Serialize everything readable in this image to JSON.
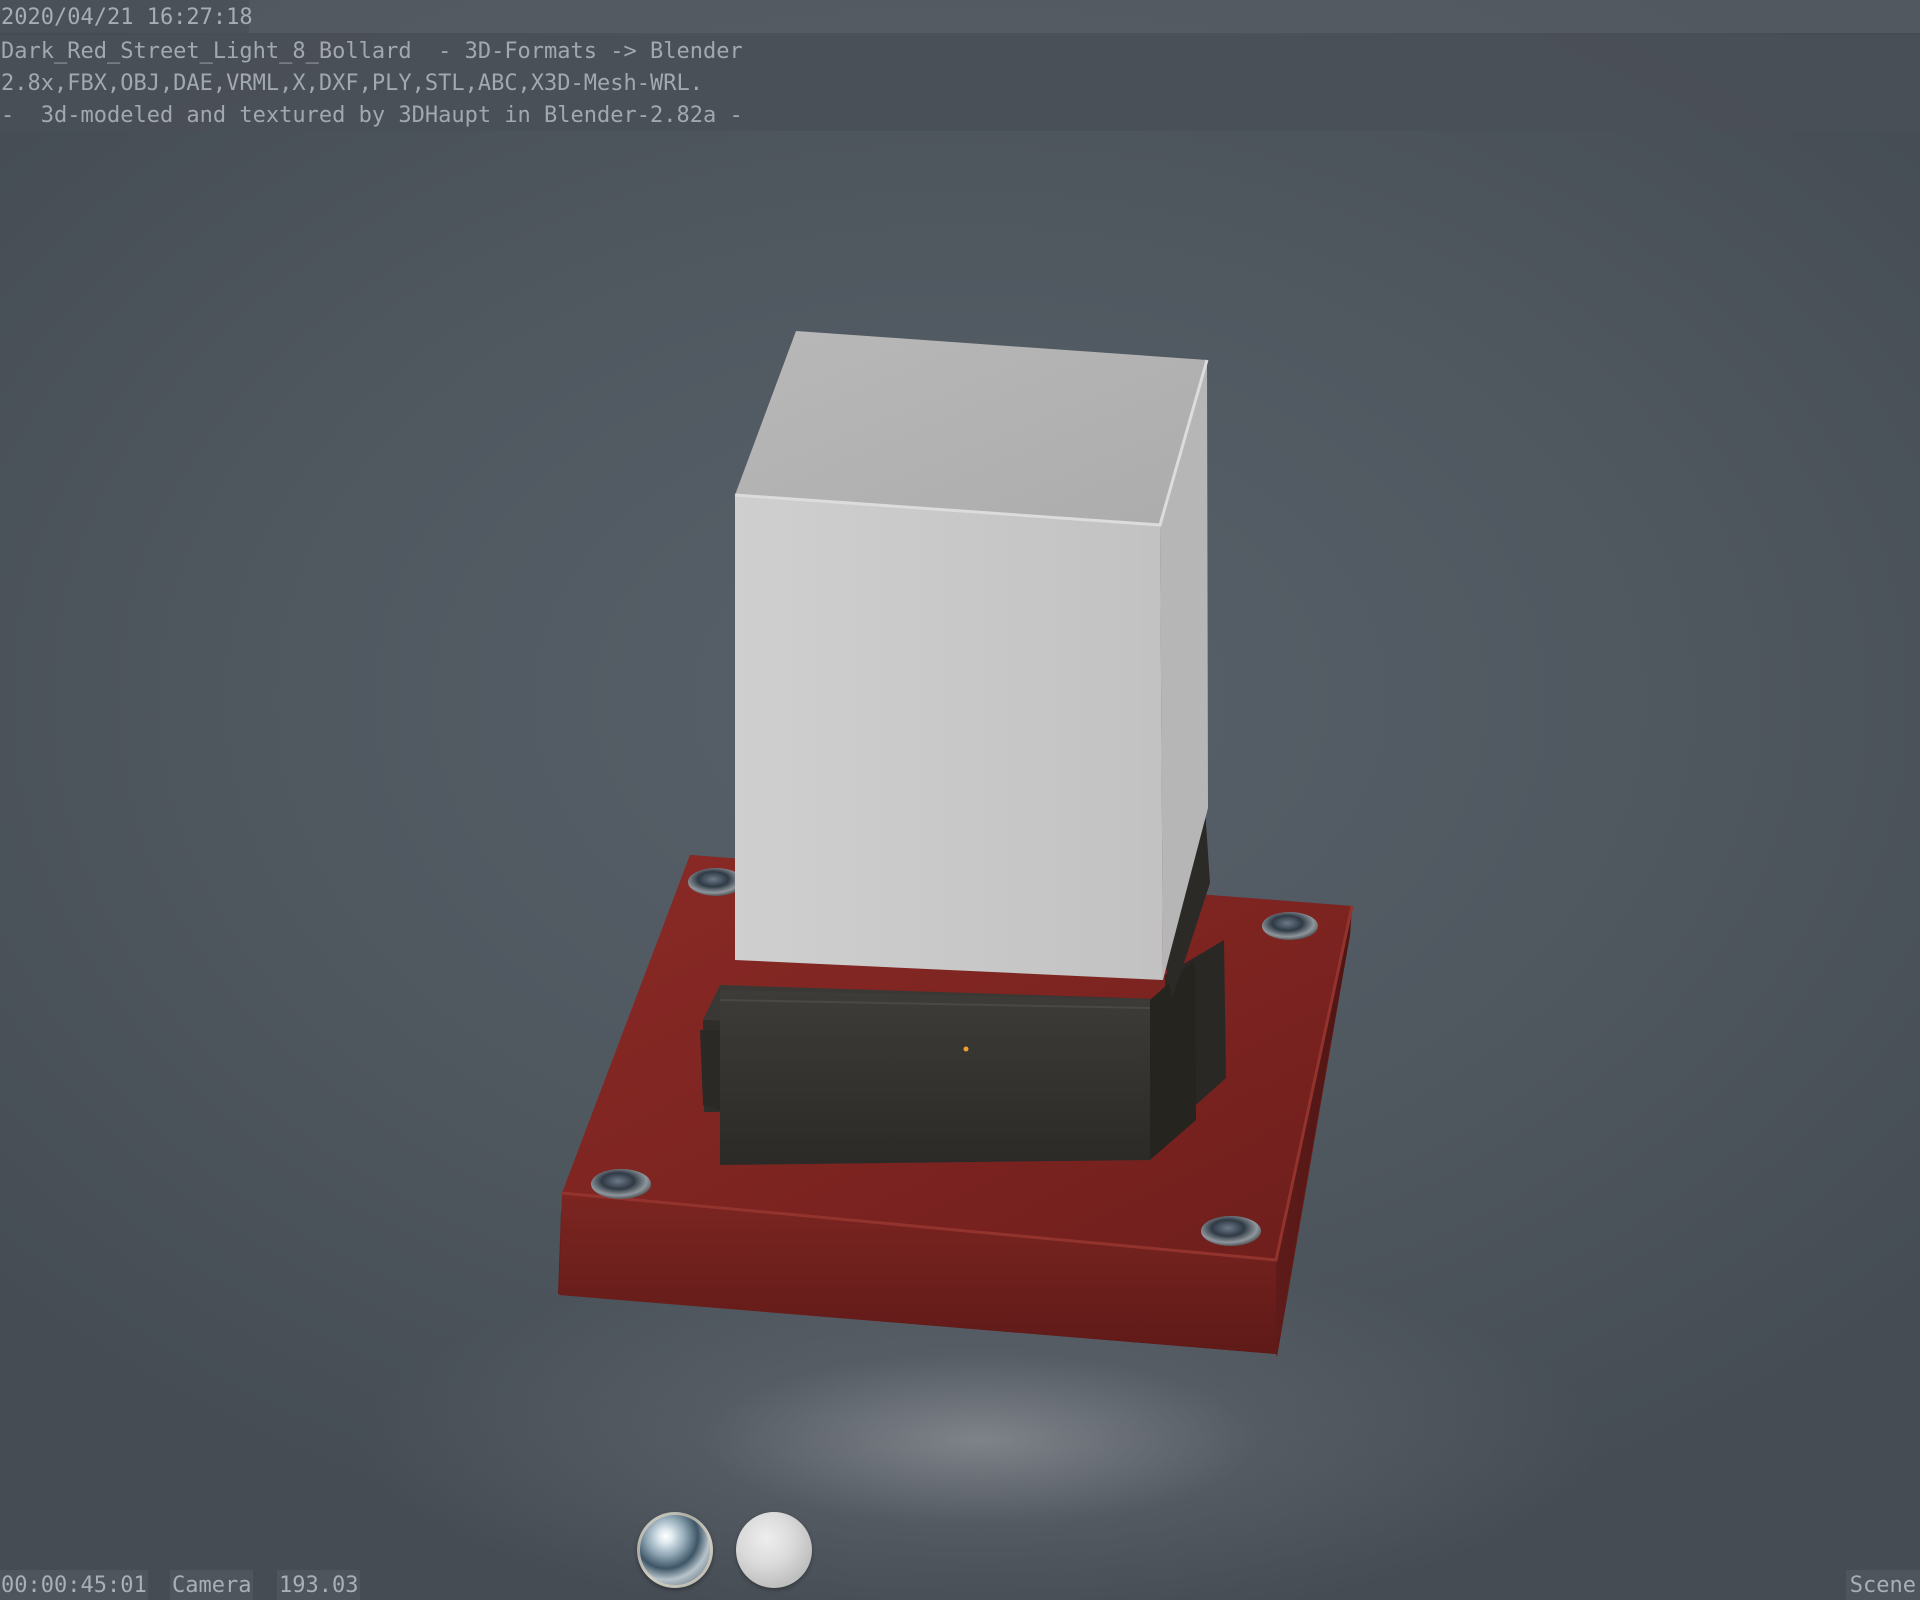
{
  "render_stamp": {
    "date": "2020/04/21 16:27:18",
    "note_line1": "Dark_Red_Street_Light_8_Bollard  - 3D-Formats -> Blender",
    "note_line2": "2.8x,FBX,OBJ,DAE,VRML,X,DXF,PLY,STL,ABC,X3D-Mesh-WRL.",
    "note_line3": "-  3d-modeled and textured by 3DHaupt in Blender-2.82a -",
    "time": "00:00:45:01",
    "camera": "Camera",
    "lens": "193.03",
    "scene": "Scene"
  },
  "colors": {
    "background": "#4f575f",
    "base_plate": "#7a2220",
    "housing": "#35332f",
    "lamp_shade": "#c9c9c9",
    "stamp_text": "#a7adb5"
  },
  "icons": {
    "matcap_chrome": "chrome-sphere",
    "matcap_diffuse": "diffuse-sphere"
  }
}
